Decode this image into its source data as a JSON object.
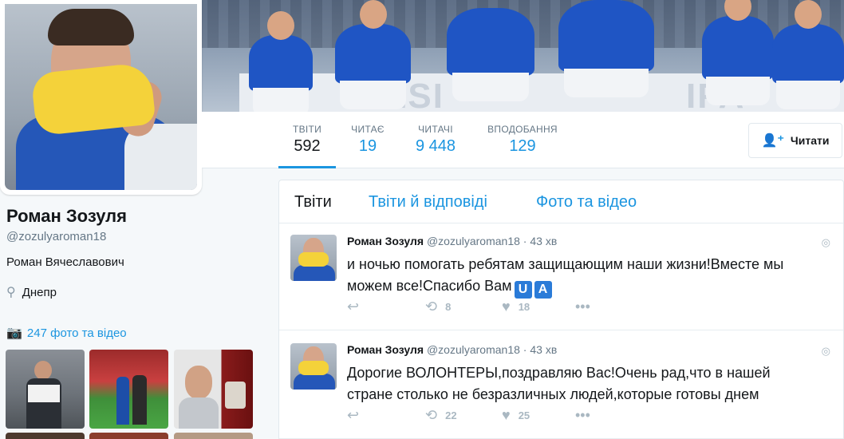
{
  "profile": {
    "name": "Роман Зозуля",
    "handle": "@zozulyaroman18",
    "bio": "Роман Вячеславович",
    "location": "Днепр",
    "media_link": "247 фото та відео"
  },
  "stats": [
    {
      "label": "ТВІТИ",
      "value": "592"
    },
    {
      "label": "ЧИТАЄ",
      "value": "19"
    },
    {
      "label": "ЧИТАЧІ",
      "value": "9 448"
    },
    {
      "label": "ВПОДОБАННЯ",
      "value": "129"
    }
  ],
  "follow_button": {
    "label": "Читати"
  },
  "tabs": [
    "Твіти",
    "Твіти й відповіді",
    "Фото та відео"
  ],
  "tweets": [
    {
      "name": "Роман Зозуля",
      "handle": "@zozulyaroman18",
      "dot": "·",
      "time": "43 хв",
      "text": "и ночью помогать ребятам защищающим наши жизни!Вместе мы можем все!Спасибо Вам",
      "flag": [
        "U",
        "A"
      ],
      "retweets": "8",
      "likes": "18"
    },
    {
      "name": "Роман Зозуля",
      "handle": "@zozulyaroman18",
      "dot": "·",
      "time": "43 хв",
      "text": "Дорогие ВОЛОНТЕРЫ,поздравляю Вас!Очень рад,что в нашей стране столько не безразличных людей,которые готовы днем",
      "flag": [],
      "retweets": "22",
      "likes": "25"
    }
  ],
  "icons": {
    "follow": "add-person-icon",
    "location": "location-pin-icon",
    "media": "camera-icon",
    "reply": "reply-icon",
    "retweet": "retweet-icon",
    "like": "heart-icon",
    "more": "more-icon",
    "globe": "globe-icon"
  },
  "colors": {
    "accent": "#1b95e0",
    "muted": "#657786",
    "background": "#f5f8fa"
  }
}
